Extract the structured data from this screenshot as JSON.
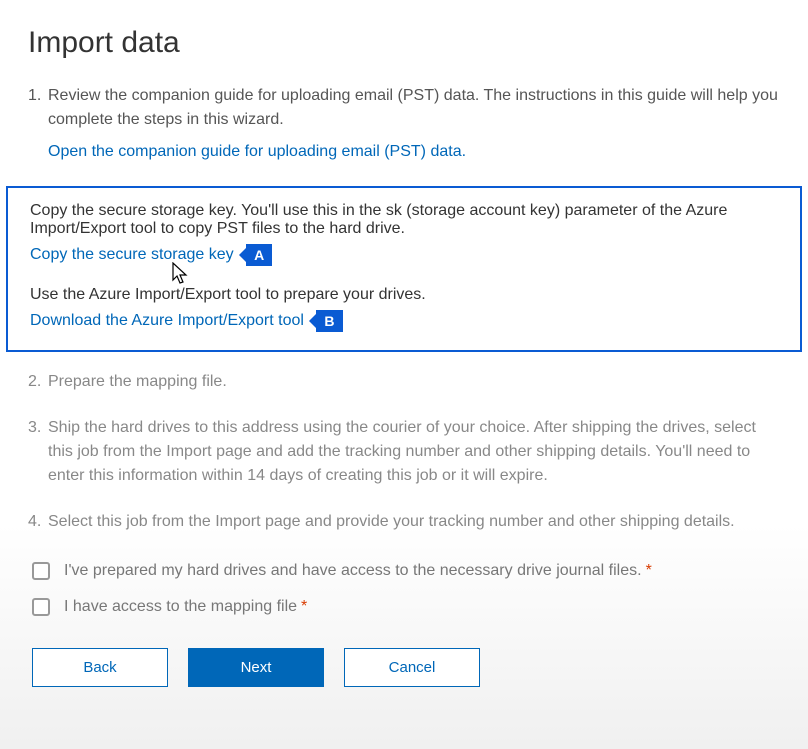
{
  "title": "Import data",
  "steps": {
    "step1_text": "Review the companion guide for uploading email (PST) data. The instructions in this guide will help you complete the steps in this wizard.",
    "step1_link": "Open the companion guide for uploading email (PST) data.",
    "step2_text": "Copy the secure storage key. You'll use this in the sk (storage account key) parameter of the Azure Import/Export tool to copy PST files to the hard drive.",
    "step2_link": "Copy the secure storage key",
    "step2_callout": "A",
    "step3_text": "Use the Azure Import/Export tool to prepare your drives.",
    "step3_link": "Download the Azure Import/Export tool",
    "step3_callout": "B",
    "step4_text": "Prepare the mapping file.",
    "step5_text": "Ship the hard drives to this address using the courier of your choice. After shipping the drives, select this job from the Import page and add the tracking number and other shipping details. You'll need to enter this information within 14 days of creating this job or it will expire.",
    "step6_text": "Select this job from the Import page and provide your tracking number and other shipping details."
  },
  "checkboxes": {
    "check1_label": "I've prepared my hard drives and have access to the necessary drive journal files.",
    "check2_label": "I have access to the mapping file",
    "required_mark": "*"
  },
  "buttons": {
    "back": "Back",
    "next": "Next",
    "cancel": "Cancel"
  }
}
